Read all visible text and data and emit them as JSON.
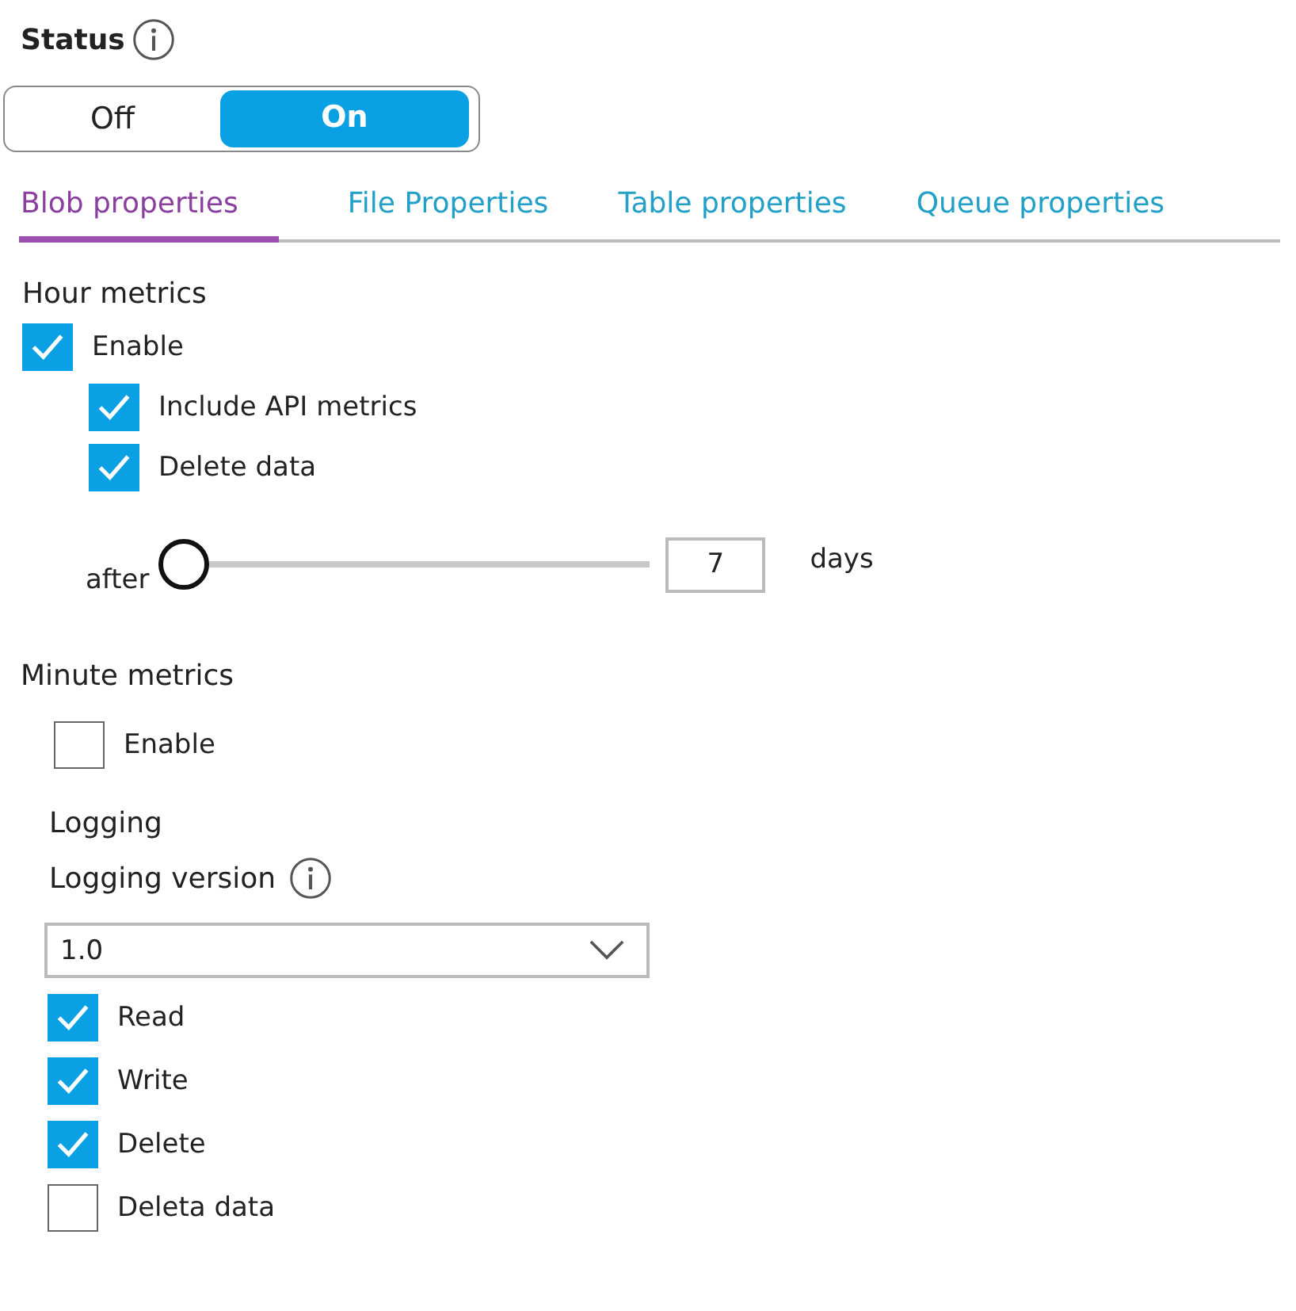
{
  "status": {
    "label": "Status",
    "options": [
      {
        "label": "Off",
        "selected": false
      },
      {
        "label": "On",
        "selected": true
      }
    ]
  },
  "tabs": [
    {
      "label": "Blob properties",
      "selected": true
    },
    {
      "label": "File Properties",
      "selected": false
    },
    {
      "label": "Table properties",
      "selected": false
    },
    {
      "label": "Queue properties",
      "selected": false
    }
  ],
  "hour_metrics": {
    "title": "Hour metrics",
    "enable": {
      "label": "Enable",
      "checked": true
    },
    "children": [
      {
        "label": "Include API metrics",
        "checked": true
      },
      {
        "label": "Delete data",
        "checked": true
      }
    ],
    "retention": {
      "prefix": "after",
      "level": 0,
      "value": "7",
      "unit": "days"
    }
  },
  "minute_metrics": {
    "title": "Minute metrics",
    "enable": {
      "label": "Enable",
      "checked": false
    }
  },
  "logging": {
    "title": "Logging",
    "version_label": "Logging version",
    "version": "1.0",
    "options": [
      {
        "label": "Read",
        "checked": true
      },
      {
        "label": "Write",
        "checked": true
      },
      {
        "label": "Delete",
        "checked": true
      },
      {
        "label": "Deleta data",
        "checked": false
      }
    ]
  }
}
